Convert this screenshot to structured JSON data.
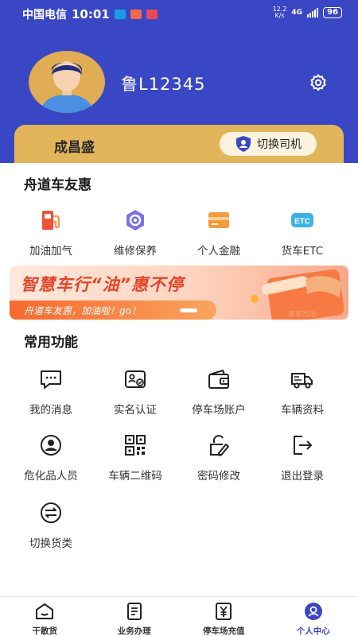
{
  "status_bar": {
    "carrier": "中国电信",
    "time": "10:01",
    "network_speed": "12.2",
    "network_unit": "K/s",
    "network_type": "4G",
    "battery": "96"
  },
  "profile": {
    "plate": "鲁L12345",
    "driver_name": "成昌盛",
    "switch_driver_label": "切换司机",
    "settings_icon": "gear-icon"
  },
  "colors": {
    "primary": "#3a47c4",
    "card_gold": "#e2b55a",
    "banner_red": "#e54528"
  },
  "benefits": {
    "title": "舟道车友惠",
    "items": [
      {
        "label": "加油加气",
        "icon": "fuel-pump-icon"
      },
      {
        "label": "维修保养",
        "icon": "maintenance-gear-icon"
      },
      {
        "label": "个人金融",
        "icon": "wallet-card-icon"
      },
      {
        "label": "货车ETC",
        "icon": "etc-icon"
      }
    ]
  },
  "banner": {
    "headline": "智慧车行“油”惠不停",
    "subtext": "舟道车友惠，加油啦！go！",
    "art_text": "惠享加油"
  },
  "common": {
    "title": "常用功能",
    "items": [
      {
        "label": "我的消息",
        "icon": "message-icon"
      },
      {
        "label": "实名认证",
        "icon": "id-card-icon"
      },
      {
        "label": "停车场账户",
        "icon": "wallet-icon"
      },
      {
        "label": "车辆资料",
        "icon": "truck-icon"
      },
      {
        "label": "危化品人员",
        "icon": "person-icon"
      },
      {
        "label": "车辆二维码",
        "icon": "qr-code-icon"
      },
      {
        "label": "密码修改",
        "icon": "lock-edit-icon"
      },
      {
        "label": "退出登录",
        "icon": "logout-icon"
      },
      {
        "label": "切换货类",
        "icon": "swap-icon"
      }
    ]
  },
  "tabbar": {
    "items": [
      {
        "label": "干散货",
        "icon": "home-icon"
      },
      {
        "label": "业务办理",
        "icon": "document-icon"
      },
      {
        "label": "停车场充值",
        "icon": "yen-icon"
      },
      {
        "label": "个人中心",
        "icon": "user-icon",
        "active": true
      }
    ]
  }
}
